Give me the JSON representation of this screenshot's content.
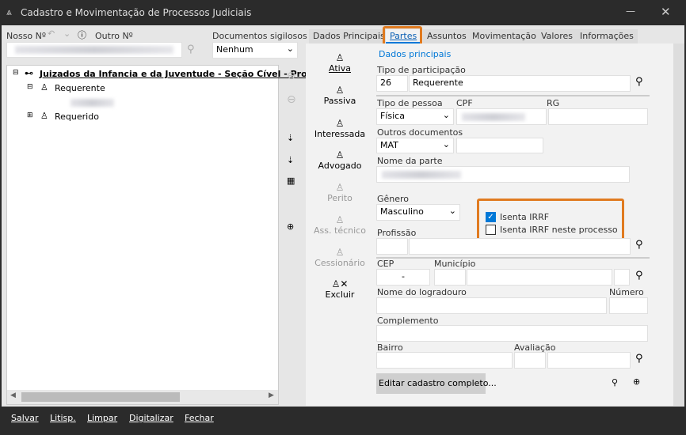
{
  "window": {
    "title": "Cadastro e Movimentação de Processos Judiciais",
    "minimize": "—",
    "close": "✕"
  },
  "left": {
    "nosso_label": "Nosso Nº",
    "outro_label": "Outro Nº",
    "docs_label": "Documentos sigilosos",
    "docs_value": "Nenhum",
    "tree": {
      "root": "Juizados da Infancia e da Juventude - Seção Cível - Proces",
      "requerente": "Requerente",
      "requerido": "Requerido"
    }
  },
  "tabs": [
    "Dados Principais",
    "Partes",
    "Assuntos",
    "Movimentação",
    "Valores",
    "Informações"
  ],
  "active_tab": "Partes",
  "side_buttons": [
    {
      "label": "Ativa",
      "icon": "person-a-icon"
    },
    {
      "label": "Passiva",
      "icon": "person-p-icon"
    },
    {
      "label": "Interessada",
      "icon": "person-i-icon"
    },
    {
      "label": "Advogado",
      "icon": "person-r-icon"
    },
    {
      "label": "Perito",
      "icon": "person-icon"
    },
    {
      "label": "Ass. técnico",
      "icon": "person-icon"
    },
    {
      "label": "Cessionário",
      "icon": "person-icon"
    },
    {
      "label": "Excluir",
      "icon": "delete-person-icon"
    }
  ],
  "form": {
    "section": "Dados principais",
    "tipo_part_label": "Tipo de participação",
    "tipo_part_code": "26",
    "tipo_part_value": "Requerente",
    "tipo_pessoa_label": "Tipo de pessoa",
    "tipo_pessoa_value": "Física",
    "cpf_label": "CPF",
    "rg_label": "RG",
    "outros_label": "Outros documentos",
    "outros_value": "MAT",
    "nome_label": "Nome da parte",
    "genero_label": "Gênero",
    "genero_value": "Masculino",
    "isenta_irrf": "Isenta IRRF",
    "isenta_irrf_checked": true,
    "isenta_proc": "Isenta IRRF neste processo",
    "isenta_proc_checked": false,
    "profissao_label": "Profissão",
    "cep_label": "CEP",
    "cep_value": "-",
    "municipio_label": "Município",
    "logradouro_label": "Nome do logradouro",
    "numero_label": "Número",
    "complemento_label": "Complemento",
    "bairro_label": "Bairro",
    "avaliacao_label": "Avaliação",
    "editar_btn": "Editar cadastro completo..."
  },
  "bottom": [
    "Salvar",
    "Litisp.",
    "Limpar",
    "Digitalizar",
    "Fechar"
  ],
  "colors": {
    "accent": "#0078d7",
    "highlight": "#e07b20"
  }
}
